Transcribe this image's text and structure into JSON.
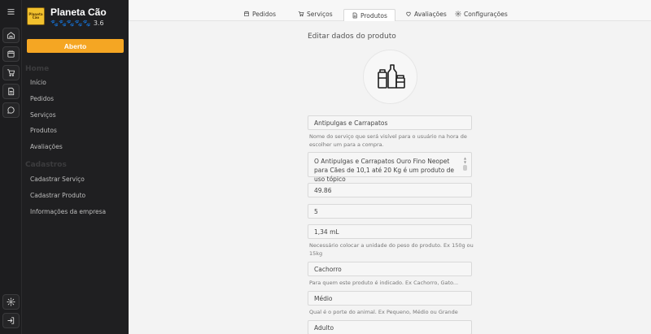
{
  "sidebar": {
    "brand_name": "Planeta Cão",
    "logo_text": "Planeta Cão",
    "rating_icons": "🐾🐾🐾🐾🐾",
    "rating_value": "3.6",
    "status_button": "Aberto",
    "sections": [
      {
        "title": "Home",
        "items": [
          "Início",
          "Pedidos",
          "Serviços",
          "Produtos",
          "Avaliações"
        ]
      },
      {
        "title": "Cadastros",
        "items": [
          "Cadastrar Serviço",
          "Cadastrar Produto",
          "Informações da empresa"
        ]
      }
    ]
  },
  "tabs": [
    {
      "label": "Pedidos",
      "icon": "calendar-icon"
    },
    {
      "label": "Serviços",
      "icon": "cart-icon"
    },
    {
      "label": "Produtos",
      "icon": "document-icon",
      "active": true
    },
    {
      "label": "Avaliações",
      "icon": "heart-icon"
    },
    {
      "label": "Configurações",
      "icon": "gear-icon"
    }
  ],
  "form": {
    "title": "Editar dados do produto",
    "name_value": "Antipulgas e Carrapatos",
    "name_hint": "Nome do serviço que será visível para o usuário na hora de escolher um para a compra.",
    "description_value": "O Antipulgas e Carrapatos Ouro Fino Neopet para Cães de 10,1 até 20 Kg é um produto de uso tópico",
    "price_value": "49.86",
    "stock_value": "5",
    "weight_value": "1,34 mL",
    "weight_hint": "Necessário colocar a unidade do peso do produto. Ex 150g ou 15kg",
    "animal_value": "Cachorro",
    "animal_hint": "Para quem este produto é indicado. Ex Cachorro, Gato...",
    "size_value": "Médio",
    "size_hint": "Qual é o porte do animal. Ex Pequeno, Médio ou Grande",
    "age_value": "Adulto"
  },
  "colors": {
    "accent": "#f5a623",
    "sidebar_bg": "#1f1f21",
    "rail_bg": "#1d1d1f"
  }
}
